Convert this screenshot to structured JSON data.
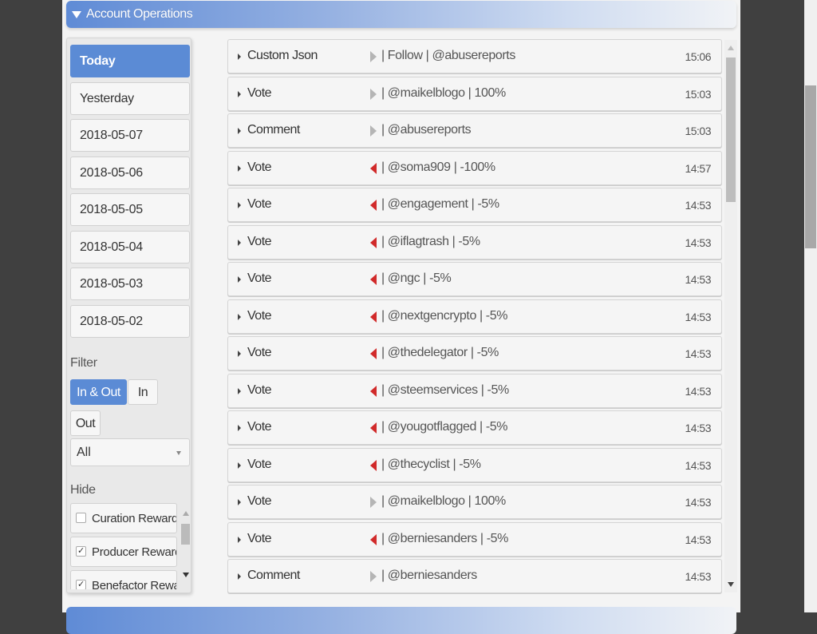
{
  "panel": {
    "title": "Account Operations"
  },
  "sidebar": {
    "dates": [
      {
        "label": "Today",
        "active": true
      },
      {
        "label": "Yesterday"
      },
      {
        "label": "2018-05-07"
      },
      {
        "label": "2018-05-06"
      },
      {
        "label": "2018-05-05"
      },
      {
        "label": "2018-05-04"
      },
      {
        "label": "2018-05-03"
      },
      {
        "label": "2018-05-02"
      }
    ],
    "filter_label": "Filter",
    "filter_options": [
      {
        "label": "In & Out",
        "active": true
      },
      {
        "label": "In"
      },
      {
        "label": "Out"
      }
    ],
    "type_select": {
      "value": "All"
    },
    "hide_label": "Hide",
    "hide_items": [
      {
        "label": "Curation Rewards",
        "checked": false,
        "mark": ""
      },
      {
        "label": "Producer Rewards",
        "checked": true,
        "mark": "✓"
      },
      {
        "label": "Benefactor Rewards",
        "checked": true,
        "mark": "✓"
      }
    ]
  },
  "operations": [
    {
      "type": "Custom Json",
      "direction": "out",
      "details": "| Follow | @abusereports",
      "time": "15:06"
    },
    {
      "type": "Vote",
      "direction": "out",
      "details": "| @maikelblogo | 100%",
      "time": "15:03"
    },
    {
      "type": "Comment",
      "direction": "out",
      "details": "| @abusereports",
      "time": "15:03"
    },
    {
      "type": "Vote",
      "direction": "in",
      "details": "| @soma909 | -100%",
      "time": "14:57"
    },
    {
      "type": "Vote",
      "direction": "in",
      "details": "| @engagement | -5%",
      "time": "14:53"
    },
    {
      "type": "Vote",
      "direction": "in",
      "details": "| @iflagtrash | -5%",
      "time": "14:53"
    },
    {
      "type": "Vote",
      "direction": "in",
      "details": "| @ngc | -5%",
      "time": "14:53"
    },
    {
      "type": "Vote",
      "direction": "in",
      "details": "| @nextgencrypto | -5%",
      "time": "14:53"
    },
    {
      "type": "Vote",
      "direction": "in",
      "details": "| @thedelegator | -5%",
      "time": "14:53"
    },
    {
      "type": "Vote",
      "direction": "in",
      "details": "| @steemservices | -5%",
      "time": "14:53"
    },
    {
      "type": "Vote",
      "direction": "in",
      "details": "| @yougotflagged | -5%",
      "time": "14:53"
    },
    {
      "type": "Vote",
      "direction": "in",
      "details": "| @thecyclist | -5%",
      "time": "14:53"
    },
    {
      "type": "Vote",
      "direction": "out",
      "details": "| @maikelblogo | 100%",
      "time": "14:53"
    },
    {
      "type": "Vote",
      "direction": "in",
      "details": "| @berniesanders | -5%",
      "time": "14:53"
    },
    {
      "type": "Comment",
      "direction": "out",
      "details": "| @berniesanders",
      "time": "14:53"
    }
  ],
  "colors": {
    "accent": "#5b8bd5",
    "incoming_arrow": "#d12a2a",
    "outgoing_arrow": "#b5b5b5"
  }
}
